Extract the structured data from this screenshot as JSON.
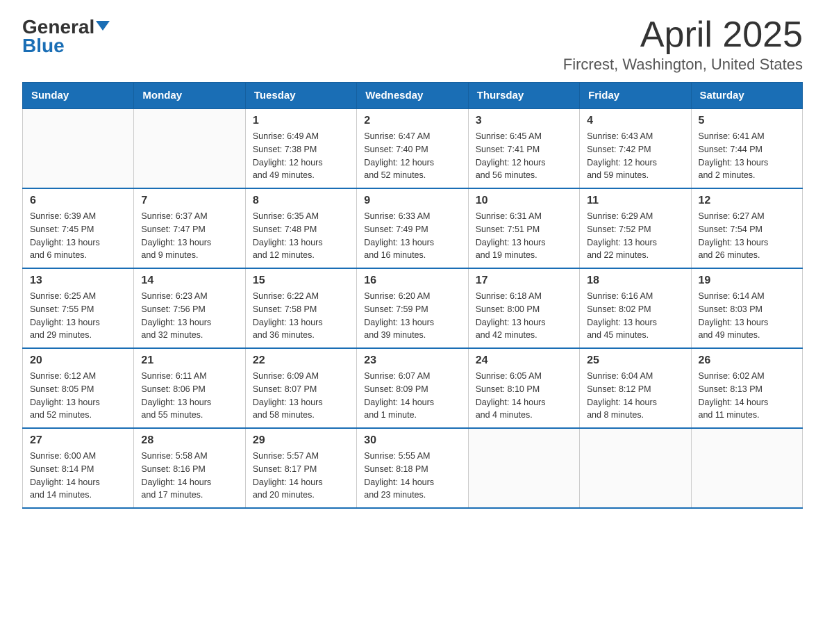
{
  "header": {
    "logo_top": "General",
    "logo_bottom": "Blue",
    "title": "April 2025",
    "subtitle": "Fircrest, Washington, United States"
  },
  "days_of_week": [
    "Sunday",
    "Monday",
    "Tuesday",
    "Wednesday",
    "Thursday",
    "Friday",
    "Saturday"
  ],
  "weeks": [
    [
      {
        "day": "",
        "info": ""
      },
      {
        "day": "",
        "info": ""
      },
      {
        "day": "1",
        "info": "Sunrise: 6:49 AM\nSunset: 7:38 PM\nDaylight: 12 hours\nand 49 minutes."
      },
      {
        "day": "2",
        "info": "Sunrise: 6:47 AM\nSunset: 7:40 PM\nDaylight: 12 hours\nand 52 minutes."
      },
      {
        "day": "3",
        "info": "Sunrise: 6:45 AM\nSunset: 7:41 PM\nDaylight: 12 hours\nand 56 minutes."
      },
      {
        "day": "4",
        "info": "Sunrise: 6:43 AM\nSunset: 7:42 PM\nDaylight: 12 hours\nand 59 minutes."
      },
      {
        "day": "5",
        "info": "Sunrise: 6:41 AM\nSunset: 7:44 PM\nDaylight: 13 hours\nand 2 minutes."
      }
    ],
    [
      {
        "day": "6",
        "info": "Sunrise: 6:39 AM\nSunset: 7:45 PM\nDaylight: 13 hours\nand 6 minutes."
      },
      {
        "day": "7",
        "info": "Sunrise: 6:37 AM\nSunset: 7:47 PM\nDaylight: 13 hours\nand 9 minutes."
      },
      {
        "day": "8",
        "info": "Sunrise: 6:35 AM\nSunset: 7:48 PM\nDaylight: 13 hours\nand 12 minutes."
      },
      {
        "day": "9",
        "info": "Sunrise: 6:33 AM\nSunset: 7:49 PM\nDaylight: 13 hours\nand 16 minutes."
      },
      {
        "day": "10",
        "info": "Sunrise: 6:31 AM\nSunset: 7:51 PM\nDaylight: 13 hours\nand 19 minutes."
      },
      {
        "day": "11",
        "info": "Sunrise: 6:29 AM\nSunset: 7:52 PM\nDaylight: 13 hours\nand 22 minutes."
      },
      {
        "day": "12",
        "info": "Sunrise: 6:27 AM\nSunset: 7:54 PM\nDaylight: 13 hours\nand 26 minutes."
      }
    ],
    [
      {
        "day": "13",
        "info": "Sunrise: 6:25 AM\nSunset: 7:55 PM\nDaylight: 13 hours\nand 29 minutes."
      },
      {
        "day": "14",
        "info": "Sunrise: 6:23 AM\nSunset: 7:56 PM\nDaylight: 13 hours\nand 32 minutes."
      },
      {
        "day": "15",
        "info": "Sunrise: 6:22 AM\nSunset: 7:58 PM\nDaylight: 13 hours\nand 36 minutes."
      },
      {
        "day": "16",
        "info": "Sunrise: 6:20 AM\nSunset: 7:59 PM\nDaylight: 13 hours\nand 39 minutes."
      },
      {
        "day": "17",
        "info": "Sunrise: 6:18 AM\nSunset: 8:00 PM\nDaylight: 13 hours\nand 42 minutes."
      },
      {
        "day": "18",
        "info": "Sunrise: 6:16 AM\nSunset: 8:02 PM\nDaylight: 13 hours\nand 45 minutes."
      },
      {
        "day": "19",
        "info": "Sunrise: 6:14 AM\nSunset: 8:03 PM\nDaylight: 13 hours\nand 49 minutes."
      }
    ],
    [
      {
        "day": "20",
        "info": "Sunrise: 6:12 AM\nSunset: 8:05 PM\nDaylight: 13 hours\nand 52 minutes."
      },
      {
        "day": "21",
        "info": "Sunrise: 6:11 AM\nSunset: 8:06 PM\nDaylight: 13 hours\nand 55 minutes."
      },
      {
        "day": "22",
        "info": "Sunrise: 6:09 AM\nSunset: 8:07 PM\nDaylight: 13 hours\nand 58 minutes."
      },
      {
        "day": "23",
        "info": "Sunrise: 6:07 AM\nSunset: 8:09 PM\nDaylight: 14 hours\nand 1 minute."
      },
      {
        "day": "24",
        "info": "Sunrise: 6:05 AM\nSunset: 8:10 PM\nDaylight: 14 hours\nand 4 minutes."
      },
      {
        "day": "25",
        "info": "Sunrise: 6:04 AM\nSunset: 8:12 PM\nDaylight: 14 hours\nand 8 minutes."
      },
      {
        "day": "26",
        "info": "Sunrise: 6:02 AM\nSunset: 8:13 PM\nDaylight: 14 hours\nand 11 minutes."
      }
    ],
    [
      {
        "day": "27",
        "info": "Sunrise: 6:00 AM\nSunset: 8:14 PM\nDaylight: 14 hours\nand 14 minutes."
      },
      {
        "day": "28",
        "info": "Sunrise: 5:58 AM\nSunset: 8:16 PM\nDaylight: 14 hours\nand 17 minutes."
      },
      {
        "day": "29",
        "info": "Sunrise: 5:57 AM\nSunset: 8:17 PM\nDaylight: 14 hours\nand 20 minutes."
      },
      {
        "day": "30",
        "info": "Sunrise: 5:55 AM\nSunset: 8:18 PM\nDaylight: 14 hours\nand 23 minutes."
      },
      {
        "day": "",
        "info": ""
      },
      {
        "day": "",
        "info": ""
      },
      {
        "day": "",
        "info": ""
      }
    ]
  ]
}
